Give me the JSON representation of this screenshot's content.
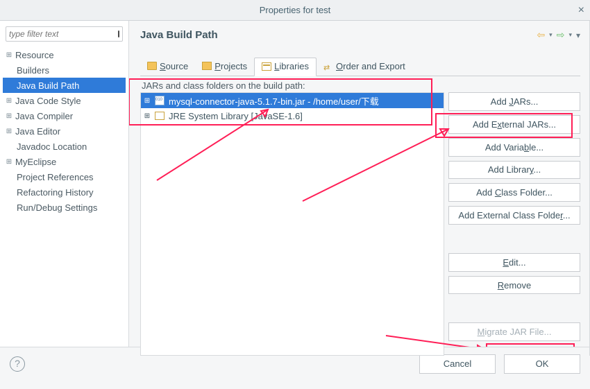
{
  "title": "Properties for test",
  "filter_placeholder": "type filter text",
  "tree": {
    "items": [
      {
        "label": "Resource"
      },
      {
        "label": "Builders"
      },
      {
        "label": "Java Build Path"
      },
      {
        "label": "Java Code Style"
      },
      {
        "label": "Java Compiler"
      },
      {
        "label": "Java Editor"
      },
      {
        "label": "Javadoc Location"
      },
      {
        "label": "MyEclipse"
      },
      {
        "label": "Project References"
      },
      {
        "label": "Refactoring History"
      },
      {
        "label": "Run/Debug Settings"
      }
    ]
  },
  "heading": "Java Build Path",
  "tabs": {
    "source": "Source",
    "projects": "Projects",
    "libraries": "Libraries",
    "order": "Order and Export"
  },
  "list_caption": "JARs and class folders on the build path:",
  "list": {
    "jar": "mysql-connector-java-5.1.7-bin.jar - /home/user/下载",
    "jre": "JRE System Library [JavaSE-1.6]"
  },
  "buttons": {
    "add_jars": "Add JARs...",
    "add_external_jars": "Add External JARs...",
    "add_variable": "Add Variable...",
    "add_library": "Add Library...",
    "add_class_folder": "Add Class Folder...",
    "add_external_class_folder": "Add External Class Folder...",
    "edit": "Edit...",
    "remove": "Remove",
    "migrate": "Migrate JAR File..."
  },
  "footer": {
    "cancel": "Cancel",
    "ok": "OK"
  }
}
